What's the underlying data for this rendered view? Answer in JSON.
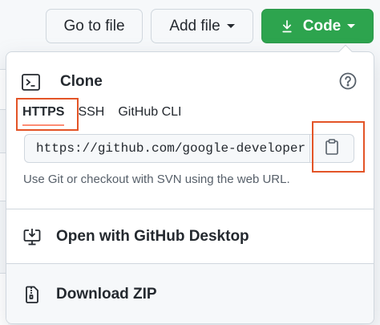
{
  "toolbar": {
    "go_to_file_label": "Go to file",
    "add_file_label": "Add file",
    "code_label": "Code",
    "code_bg_color": "#2da44e"
  },
  "clone": {
    "title": "Clone",
    "tabs": [
      {
        "label": "HTTPS",
        "active": true
      },
      {
        "label": "SSH",
        "active": false
      },
      {
        "label": "GitHub CLI",
        "active": false
      }
    ],
    "url_value": "https://github.com/google-developer",
    "hint": "Use Git or checkout with SVN using the web URL.",
    "icons": {
      "header": "terminal-icon",
      "help": "question-circle-icon",
      "copy": "clipboard-icon"
    },
    "highlight_color": "#e35427"
  },
  "menu": {
    "desktop_label": "Open with GitHub Desktop",
    "zip_label": "Download ZIP",
    "desktop_icon": "desktop-download-icon",
    "zip_icon": "file-zip-icon"
  }
}
